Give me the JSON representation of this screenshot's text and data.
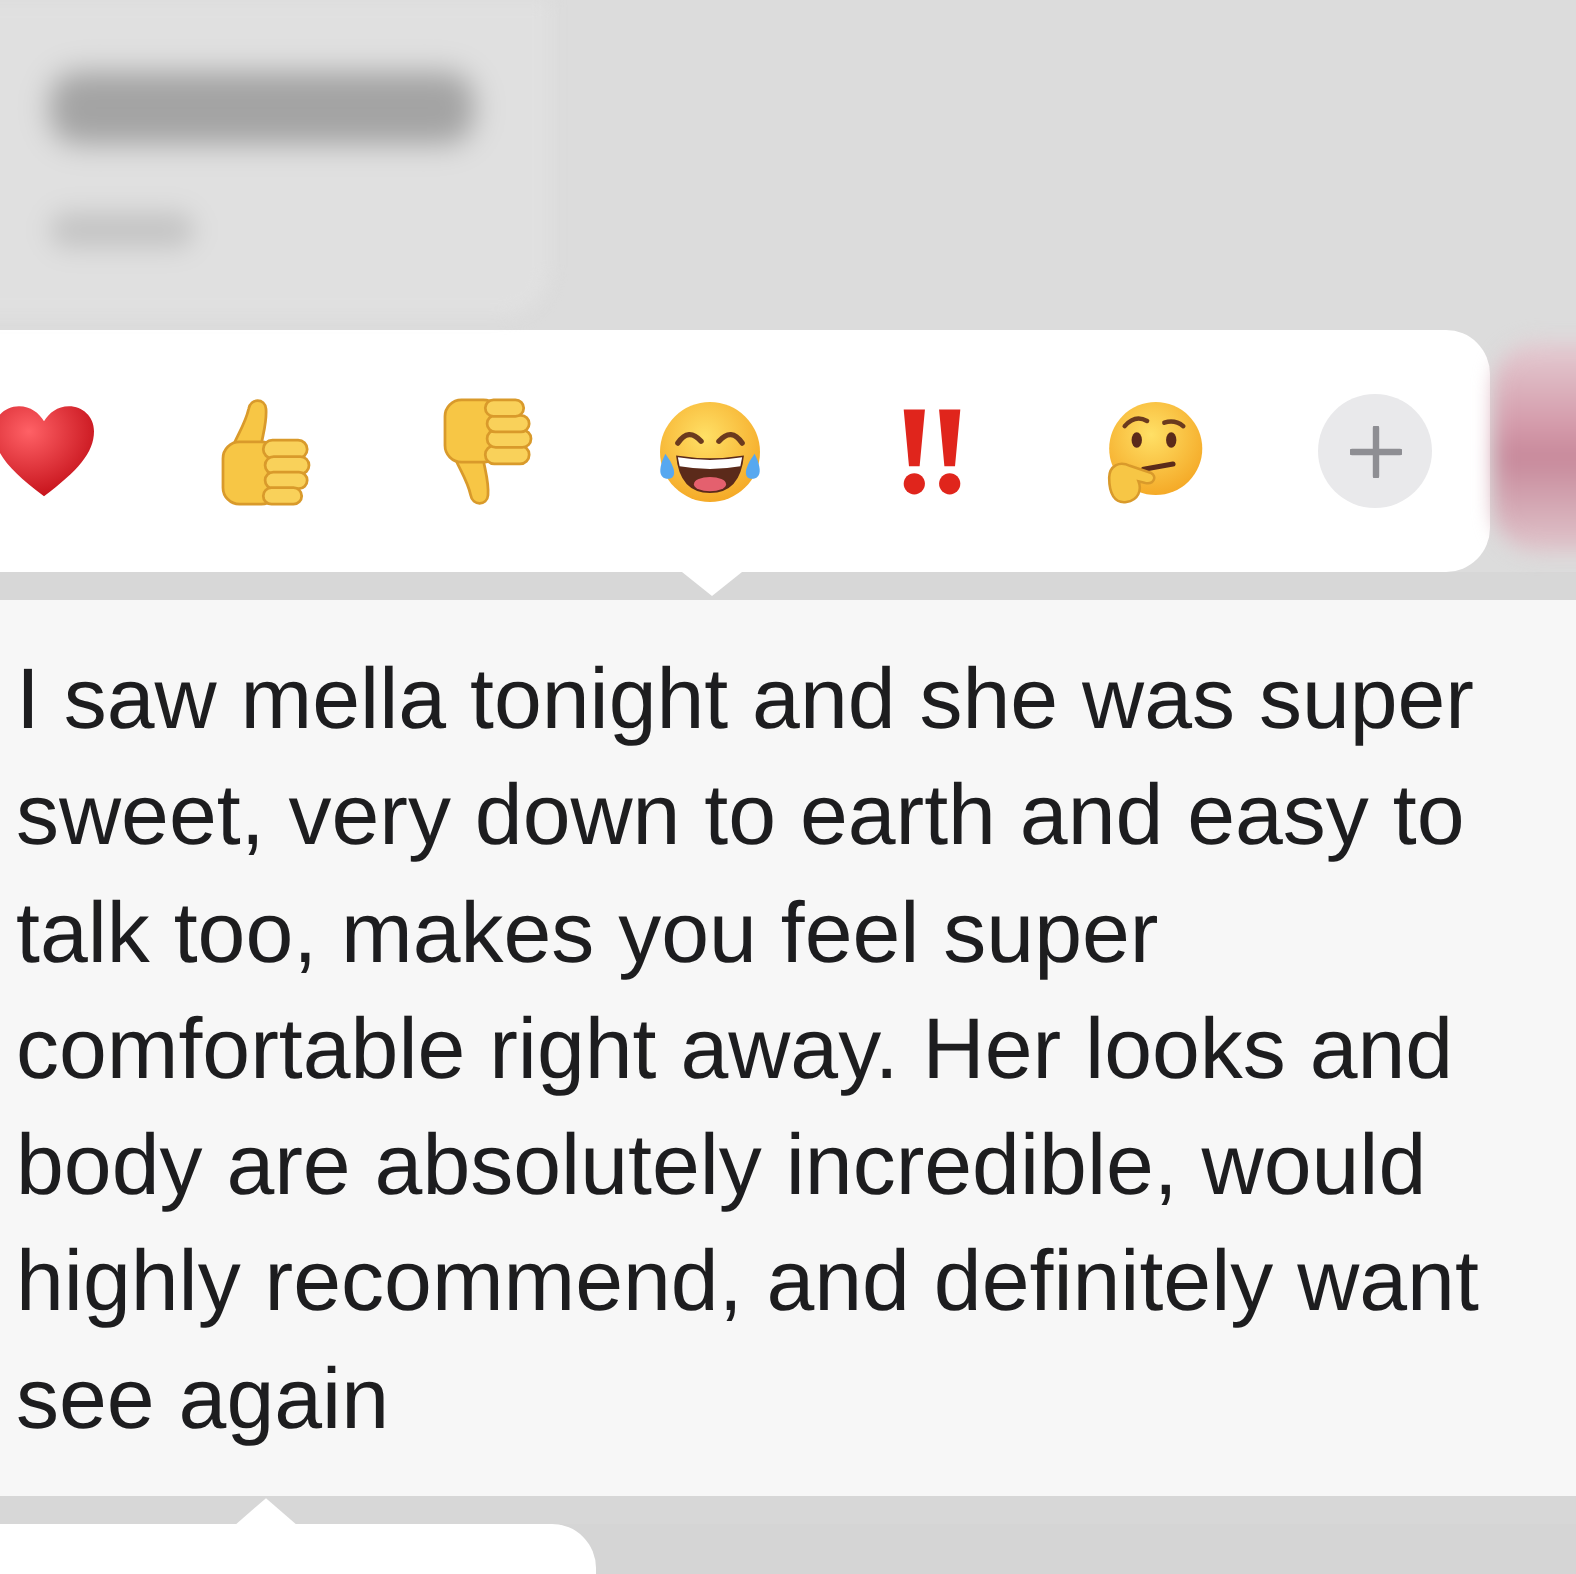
{
  "reaction_bar": {
    "reactions": [
      {
        "kind": "heart"
      },
      {
        "kind": "thumbs_up"
      },
      {
        "kind": "thumbs_down"
      },
      {
        "kind": "laughing"
      },
      {
        "kind": "double_exclamation"
      },
      {
        "kind": "thinking"
      },
      {
        "kind": "add"
      }
    ]
  },
  "message": {
    "text": "I saw mella tonight and she was super\nsweet, very down to earth and easy to\ntalk too, makes you feel super\ncomfortable right away. Her looks and\nbody are absolutely incredible, would\nhighly recommend, and definitely want\nsee again"
  }
}
